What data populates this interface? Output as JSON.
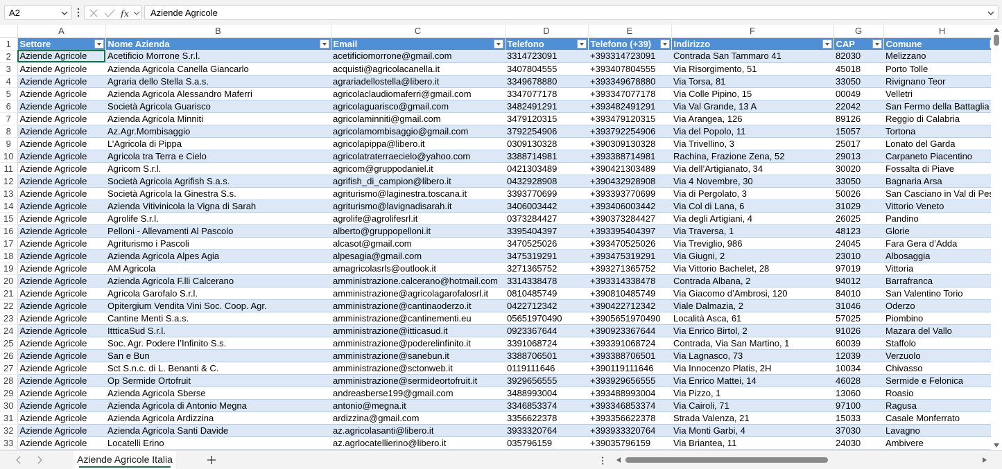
{
  "formula_bar": {
    "name_box": "A2",
    "content": "Aziende Agricole"
  },
  "columns": [
    "A",
    "B",
    "C",
    "D",
    "E",
    "F",
    "G",
    "H"
  ],
  "headers": [
    "Settore",
    "Nome Azienda",
    "Email",
    "Telefono",
    "Telefono (+39)",
    "Indirizzo",
    "CAP",
    "Comune"
  ],
  "rows": [
    {
      "n": "2",
      "cells": [
        "Aziende Agricole",
        "Acetificio Morrone S.r.l.",
        "acetificiomorrone@gmail.com",
        "3314723091",
        "+393314723091",
        "Contrada San Tammaro 41",
        "82030",
        "Melizzano"
      ]
    },
    {
      "n": "3",
      "cells": [
        "Aziende Agricole",
        "Azienda Agricola Canella Giancarlo",
        "acquisti@agricolacanella.it",
        "3407804555",
        "+393407804555",
        "Via Risorgimento, 51",
        "45018",
        "Porto Tolle"
      ]
    },
    {
      "n": "4",
      "cells": [
        "Aziende Agricole",
        "Agraria dello Stella S.a.s.",
        "agrariadellostella@libero.it",
        "3349678880",
        "+393349678880",
        "Via Torsa, 81",
        "33050",
        "Rivignano Teor"
      ]
    },
    {
      "n": "5",
      "cells": [
        "Aziende Agricole",
        "Azienda Agricola Alessandro Maferri",
        "agricolaclaudiomaferri@gmail.com",
        "3347077178",
        "+393347077178",
        "Via Colle Pipino, 15",
        "00049",
        "Velletri"
      ]
    },
    {
      "n": "6",
      "cells": [
        "Aziende Agricole",
        "Società Agricola Guarisco",
        "agricolaguarisco@gmail.com",
        "3482491291",
        "+393482491291",
        "Via Val Grande, 13 A",
        "22042",
        "San Fermo della Battaglia"
      ]
    },
    {
      "n": "7",
      "cells": [
        "Aziende Agricole",
        "Azienda Agricola Minniti",
        "agricolaminniti@gmail.com",
        "3479120315",
        "+393479120315",
        "Via Arangea, 126",
        "89126",
        "Reggio di Calabria"
      ]
    },
    {
      "n": "8",
      "cells": [
        "Aziende Agricole",
        "Az.Agr.Mombisaggio",
        "agricolamombisaggio@gmail.com",
        "3792254906",
        "+393792254906",
        "Via del Popolo, 11",
        "15057",
        "Tortona"
      ]
    },
    {
      "n": "9",
      "cells": [
        "Aziende Agricole",
        "L’Agricola di Pippa",
        "agricolapippa@libero.it",
        "0309130328",
        "+390309130328",
        "Via Trivellino, 3",
        "25017",
        "Lonato del Garda"
      ]
    },
    {
      "n": "10",
      "cells": [
        "Aziende Agricole",
        "Agricola tra Terra e Cielo",
        "agricolatraterraecielo@yahoo.com",
        "3388714981",
        "+393388714981",
        "Rachina, Frazione Zena, 52",
        "29013",
        "Carpaneto Piacentino"
      ]
    },
    {
      "n": "11",
      "cells": [
        "Aziende Agricole",
        "Agricom S.r.l.",
        "agricom@gruppodaniel.it",
        "0421303489",
        "+390421303489",
        "Via dell’Artigianato, 34",
        "30020",
        "Fossalta di Piave"
      ]
    },
    {
      "n": "12",
      "cells": [
        "Aziende Agricole",
        "Società Agricola Agrifish S.a.s.",
        "agrifish_di_campion@libero.it",
        "0432928908",
        "+390432928908",
        "Via 4 Novembre, 30",
        "33050",
        "Bagnaria Arsa"
      ]
    },
    {
      "n": "13",
      "cells": [
        "Aziende Agricole",
        "Società Agricola la Ginestra S.s.",
        "agriturismo@laginestra.toscana.it",
        "3393770699",
        "+393393770699",
        "Via di Pergolato, 3",
        "50026",
        "San Casciano in Val di Pesa"
      ]
    },
    {
      "n": "14",
      "cells": [
        "Aziende Agricole",
        "Azienda Vitivinicola la Vigna di Sarah",
        "agriturismo@lavignadisarah.it",
        "3406003442",
        "+393406003442",
        "Via Col di Lana, 6",
        "31029",
        "Vittorio Veneto"
      ]
    },
    {
      "n": "15",
      "cells": [
        "Aziende Agricole",
        "Agrolife S.r.l.",
        "agrolife@agrolifesrl.it",
        "0373284427",
        "+390373284427",
        "Via degli Artigiani, 4",
        "26025",
        "Pandino"
      ]
    },
    {
      "n": "16",
      "cells": [
        "Aziende Agricole",
        "Pelloni - Allevamenti Al Pascolo",
        "alberto@gruppopelloni.it",
        "3395404397",
        "+393395404397",
        "Via Traversa, 1",
        "48123",
        "Glorie"
      ]
    },
    {
      "n": "17",
      "cells": [
        "Aziende Agricole",
        "Agriturismo i Pascoli",
        "alcasot@gmail.com",
        "3470525026",
        "+393470525026",
        "Via Treviglio, 986",
        "24045",
        "Fara Gera d’Adda"
      ]
    },
    {
      "n": "18",
      "cells": [
        "Aziende Agricole",
        "Azienda Agricola Alpes Agia",
        "alpesagia@gmail.com",
        "3475319291",
        "+393475319291",
        "Via Giugni, 2",
        "23010",
        "Albosaggia"
      ]
    },
    {
      "n": "19",
      "cells": [
        "Aziende Agricole",
        "AM Agricola",
        "amagricolasrls@outlook.it",
        "3271365752",
        "+393271365752",
        "Via Vittorio Bachelet, 28",
        "97019",
        "Vittoria"
      ]
    },
    {
      "n": "20",
      "cells": [
        "Aziende Agricole",
        "Azienda Agricola F.lli Calcerano",
        "amministrazione.calcerano@hotmail.com",
        "3314338478",
        "+393314338478",
        "Contrada Albana, 2",
        "94012",
        "Barrafranca"
      ]
    },
    {
      "n": "21",
      "cells": [
        "Aziende Agricole",
        "Agricola Garofalo S.r.l.",
        "amministrazione@agricolagarofalosrl.it",
        "0810485749",
        "+390810485749",
        "Via Giacomo d’Ambrosi, 120",
        "84010",
        "San Valentino Torio"
      ]
    },
    {
      "n": "22",
      "cells": [
        "Aziende Agricole",
        "Opitergium Vendita Vini Soc. Coop. Agr.",
        "amministrazione@cantinaoderzo.it",
        "0422712342",
        "+390422712342",
        "Viale Dalmazia, 2",
        "31046",
        "Oderzo"
      ]
    },
    {
      "n": "23",
      "cells": [
        "Aziende Agricole",
        "Cantine Menti S.a.s.",
        "amministrazione@cantinementi.eu",
        "05651970490",
        "+3905651970490",
        "Località Asca, 61",
        "57025",
        "Piombino"
      ]
    },
    {
      "n": "24",
      "cells": [
        "Aziende Agricole",
        "IttticaSud S.r.l.",
        "amministrazione@itticasud.it",
        "0923367644",
        "+390923367644",
        "Via Enrico Birtol, 2",
        "91026",
        "Mazara del Vallo"
      ]
    },
    {
      "n": "25",
      "cells": [
        "Aziende Agricole",
        "Soc. Agr. Podere l’Infinito S.s.",
        "amministrazione@poderelinfinito.it",
        "3391068724",
        "+393391068724",
        "Contrada, Via San Martino, 1",
        "60039",
        "Staffolo"
      ]
    },
    {
      "n": "26",
      "cells": [
        "Aziende Agricole",
        "San e Bun",
        "amministrazione@sanebun.it",
        "3388706501",
        "+393388706501",
        "Via Lagnasco, 73",
        "12039",
        "Verzuolo"
      ]
    },
    {
      "n": "27",
      "cells": [
        "Aziende Agricole",
        "Sct S.n.c. di L. Benanti & C.",
        "amministrazione@sctonweb.it",
        "0119111646",
        "+390119111646",
        "Via Innocenzo Platis, 2H",
        "10034",
        "Chivasso"
      ]
    },
    {
      "n": "28",
      "cells": [
        "Aziende Agricole",
        "Op Sermide Ortofruit",
        "amministrazione@sermideortofruit.it",
        "3929656555",
        "+393929656555",
        "Via Enrico Mattei, 14",
        "46028",
        "Sermide e Felonica"
      ]
    },
    {
      "n": "29",
      "cells": [
        "Aziende Agricole",
        "Azienda Agricola Sberse",
        "andreasberse199@gmail.com",
        "3488993004",
        "+393488993004",
        "Via Pizzo, 1",
        "13060",
        "Roasio"
      ]
    },
    {
      "n": "30",
      "cells": [
        "Aziende Agricole",
        "Azienda Agricola di Antonio Megna",
        "antonio@megna.it",
        "3346853374",
        "+393346853374",
        "Via Cairoli, 71",
        "97100",
        "Ragusa"
      ]
    },
    {
      "n": "31",
      "cells": [
        "Aziende Agricole",
        "Azienda Agricola Ardizzina",
        "ardizzina@gmail.com",
        "3356622378",
        "+393356622378",
        "Strada Valenza, 21",
        "15033",
        "Casale Monferrato"
      ]
    },
    {
      "n": "32",
      "cells": [
        "Aziende Agricole",
        "Azienda Agricola Santi Davide",
        "az.agricolasanti@libero.it",
        "3933320764",
        "+393933320764",
        "Via Monti Garbi, 4",
        "37030",
        "Lavagno"
      ]
    },
    {
      "n": "33",
      "cells": [
        "Aziende Agricole",
        "Locatelli Erino",
        "az.agrlocatellierino@libero.it",
        "035796159",
        "+39035796159",
        "Via Briantea, 11",
        "24030",
        "Ambivere"
      ]
    }
  ],
  "sheet_tabs": [
    "Aziende Agricole Italia"
  ],
  "colors": {
    "header_fill": "#4f8fd6",
    "band_fill": "#dce8f5",
    "selection": "#1e7145"
  },
  "icons": {
    "name_box_dropdown": "chevron-down-icon",
    "cancel": "close-icon",
    "enter": "check-icon",
    "function": "fx-icon",
    "add_sheet": "plus-icon"
  }
}
